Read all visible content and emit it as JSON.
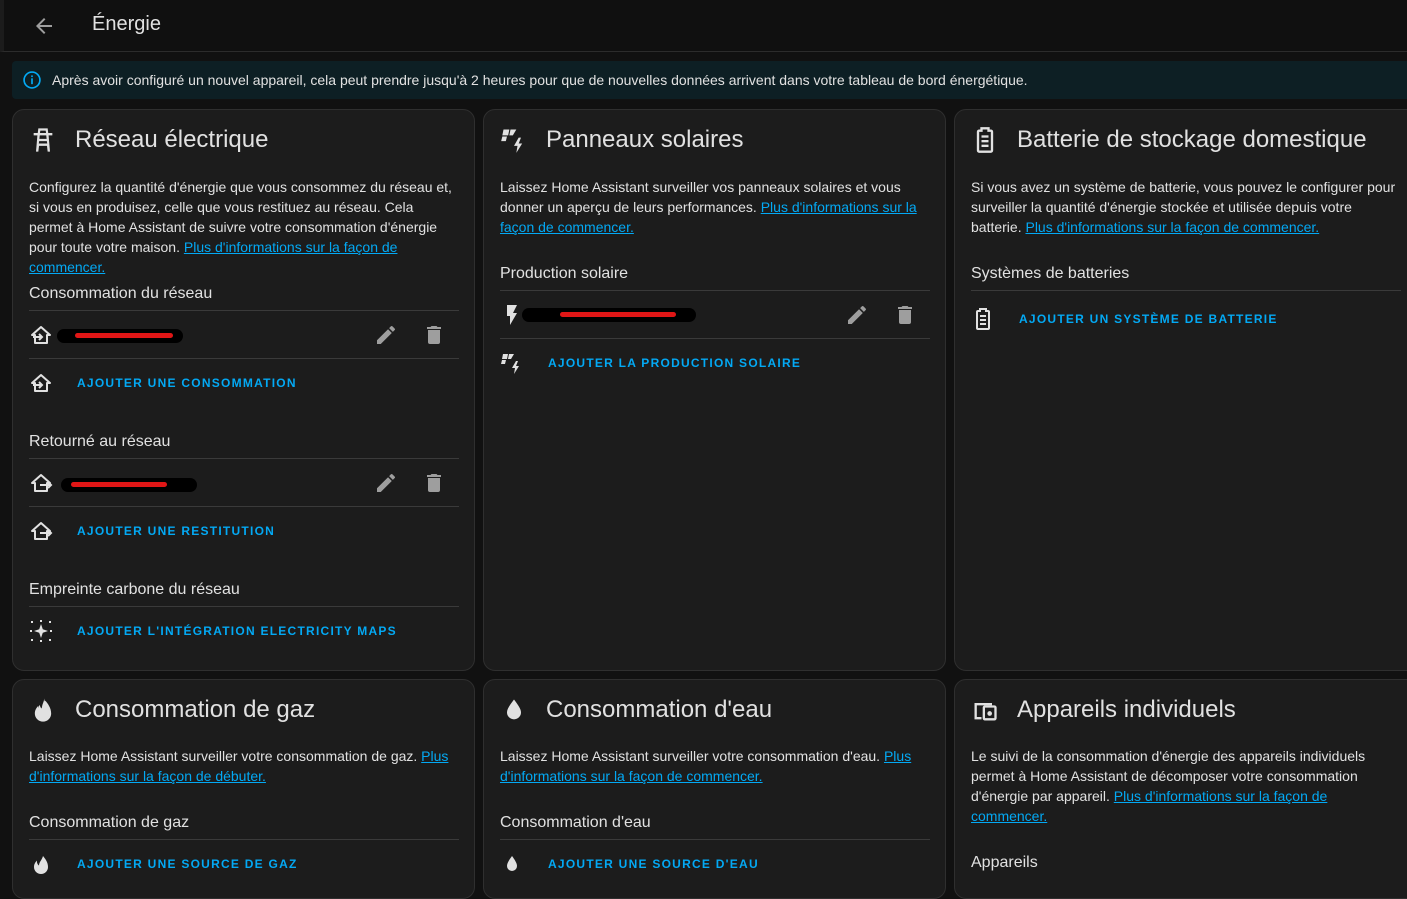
{
  "header": {
    "title": "Énergie",
    "back_icon": "arrow-left-icon"
  },
  "banner": {
    "icon": "info-circle-icon",
    "text": "Après avoir configuré un nouvel appareil, cela peut prendre jusqu'à 2 heures pour que de nouvelles données arrivent dans votre tableau de bord énergétique."
  },
  "grid": {
    "title": "Réseau électrique",
    "icon": "transmission-tower-icon",
    "description": "Configurez la quantité d'énergie que vous consommez du réseau et, si vous en produisez, celle que vous restituez au réseau. Cela permet à Home Assistant de suivre votre consommation d'énergie pour toute votre maison.",
    "link": "Plus d'informations sur la façon de commencer.",
    "consumption_title": "Consommation du réseau",
    "add_consumption": "AJOUTER UNE CONSOMMATION",
    "return_title": "Retourné au réseau",
    "add_return": "AJOUTER UNE RESTITUTION",
    "carbon_title": "Empreinte carbone du réseau",
    "add_carbon": "AJOUTER L'INTÉGRATION ELECTRICITY MAPS"
  },
  "solar": {
    "title": "Panneaux solaires",
    "icon": "solar-power-icon",
    "description": "Laissez Home Assistant surveiller vos panneaux solaires et vous donner un aperçu de leurs performances.",
    "link": "Plus d'informations sur la façon de commencer.",
    "production_title": "Production solaire",
    "add_production": "AJOUTER LA PRODUCTION SOLAIRE"
  },
  "battery": {
    "title": "Batterie de stockage domestique",
    "icon": "battery-icon",
    "description": "Si vous avez un système de batterie, vous pouvez le configurer pour surveiller la quantité d'énergie stockée et utilisée depuis votre batterie.",
    "link": "Plus d'informations sur la façon de commencer.",
    "systems_title": "Systèmes de batteries",
    "add_system": "AJOUTER UN SYSTÈME DE BATTERIE"
  },
  "gas": {
    "title": "Consommation de gaz",
    "icon": "fire-icon",
    "description": "Laissez Home Assistant surveiller votre consommation de gaz.",
    "link": "Plus d'informations sur la façon de débuter.",
    "section_title": "Consommation de gaz",
    "add_source": "AJOUTER UNE SOURCE DE GAZ"
  },
  "water": {
    "title": "Consommation d'eau",
    "icon": "water-drop-icon",
    "description": "Laissez Home Assistant surveiller votre consommation d'eau.",
    "link": "Plus d'informations sur la façon de commencer.",
    "section_title": "Consommation d'eau",
    "add_source": "AJOUTER UNE SOURCE D'EAU"
  },
  "devices": {
    "title": "Appareils individuels",
    "icon": "devices-icon",
    "description": "Le suivi de la consommation d'énergie des appareils individuels permet à Home Assistant de décomposer votre consommation d'énergie par appareil.",
    "link": "Plus d'informations sur la façon de commencer.",
    "section_title": "Appareils"
  },
  "colors": {
    "accent": "#03a9f4",
    "card": "#1c1c1c",
    "background": "#111111",
    "redaction": "#e01616"
  }
}
